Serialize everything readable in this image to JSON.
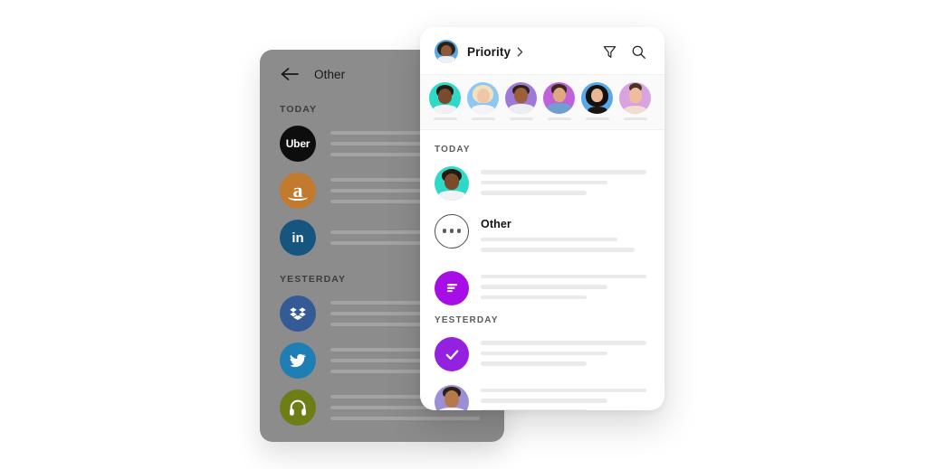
{
  "back_panel": {
    "back_icon": "arrow-left-icon",
    "title": "Other",
    "sections": [
      {
        "label": "TODAY",
        "rows": [
          {
            "app": "Uber",
            "icon": "uber-icon",
            "text": "Uber",
            "bg": "#0d0d0d",
            "lines": [
              86,
              86,
              86
            ]
          },
          {
            "app": "Amazon",
            "icon": "amazon-icon",
            "text": "a",
            "bg": "#c27a2e",
            "lines": [
              86,
              86,
              86
            ]
          },
          {
            "app": "LinkedIn",
            "icon": "linkedin-icon",
            "text": "in",
            "bg": "#15557f",
            "lines": [
              86,
              86
            ]
          }
        ]
      },
      {
        "label": "YESTERDAY",
        "rows": [
          {
            "app": "Dropbox",
            "icon": "dropbox-icon",
            "text": "",
            "bg": "#355b96",
            "lines": [
              86,
              86,
              86
            ]
          },
          {
            "app": "Twitter",
            "icon": "twitter-icon",
            "text": "",
            "bg": "#1f7fb5",
            "lines": [
              86,
              86,
              86
            ]
          },
          {
            "app": "Olive",
            "icon": "headset-icon",
            "text": "",
            "bg": "#6f7d17",
            "lines": [
              86,
              86,
              86
            ]
          }
        ]
      }
    ]
  },
  "front_card": {
    "header": {
      "avatar": "user-avatar",
      "title": "Priority",
      "chevron": "chevron-right-icon",
      "filter_icon": "filter-icon",
      "search_icon": "search-icon"
    },
    "avatar_strip": [
      {
        "name": "contact-1",
        "bg": "#2fd9c8",
        "icon": "avatar"
      },
      {
        "name": "contact-2",
        "bg": "#8ec7f2",
        "icon": "avatar"
      },
      {
        "name": "contact-3",
        "bg": "#9d7ad6",
        "icon": "avatar"
      },
      {
        "name": "contact-4",
        "bg": "#c061d8",
        "icon": "avatar"
      },
      {
        "name": "contact-5",
        "bg": "#5aa8e8",
        "icon": "avatar"
      },
      {
        "name": "contact-6",
        "bg": "#d9a3e0",
        "icon": "avatar"
      }
    ],
    "sections": [
      {
        "label": "TODAY",
        "rows": [
          {
            "icon": "avatar",
            "kind": "photo",
            "bg": "#2fd9c8",
            "label": "",
            "lines": [
              97,
              74,
              62
            ]
          },
          {
            "icon": "more-icon",
            "kind": "outline",
            "bg": "#ffffff",
            "label": "Other",
            "lines": [
              80,
              90
            ]
          },
          {
            "icon": "list-icon",
            "kind": "glyph",
            "bg": "#a70ee6",
            "label": "",
            "lines": [
              97,
              74,
              62
            ]
          }
        ]
      },
      {
        "label": "YESTERDAY",
        "rows": [
          {
            "icon": "check-icon",
            "kind": "glyph",
            "bg": "#9420e0",
            "label": "",
            "lines": [
              97,
              74,
              62
            ]
          },
          {
            "icon": "avatar",
            "kind": "photo",
            "bg": "#9d8fd6",
            "label": "",
            "lines": [
              97,
              74,
              62
            ]
          }
        ]
      }
    ]
  },
  "colors": {
    "panel_gray": "#8c8c8c",
    "card_white": "#ffffff",
    "accent_purple": "#a70ee6",
    "accent_violet": "#9420e0",
    "skeleton": "#eaeaea",
    "skeleton_dark": "#a3a3a3"
  }
}
